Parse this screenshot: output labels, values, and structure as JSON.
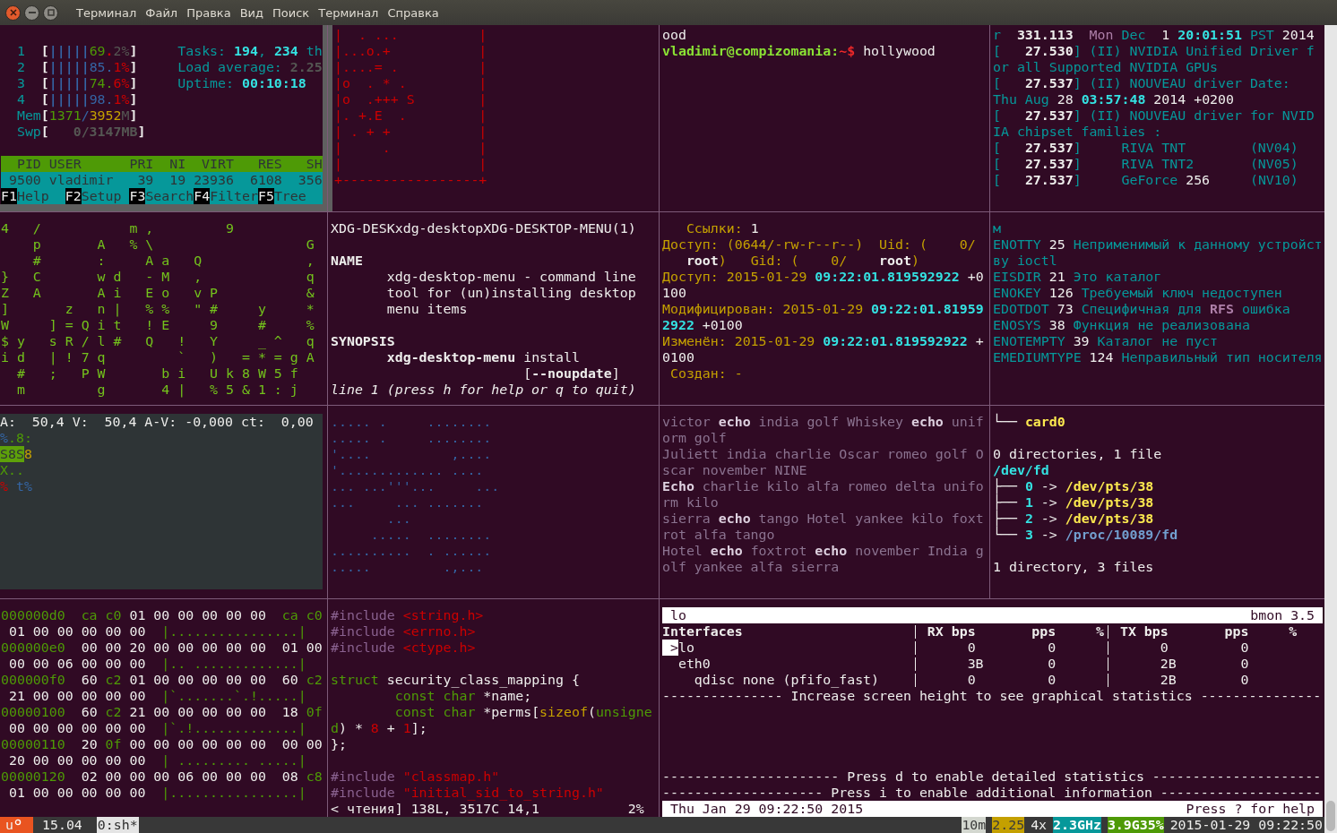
{
  "window": {
    "menu": [
      "Терминал",
      "Файл",
      "Правка",
      "Вид",
      "Поиск",
      "Терминал",
      "Справка"
    ]
  },
  "panes": [
    {
      "kind": "htop",
      "color": "#eeeeec",
      "lines": [
        {
          "kind": "blank"
        },
        {
          "kind": "text",
          "spans": [
            {
              "text": "  1  ",
              "color": "#06989a"
            },
            {
              "text": "[",
              "bold": true
            },
            {
              "text": "|||||",
              "color": "#3465a4",
              "bold": true
            },
            {
              "text": "69",
              "color": "#4e9a06"
            },
            {
              "text": ".",
              "color": "#cc0000",
              "bold": true
            },
            {
              "text": "2%",
              "color": "#555753"
            },
            {
              "text": "]",
              "bold": true
            },
            {
              "text": "     Tasks: ",
              "color": "#06989a"
            },
            {
              "text": "194",
              "color": "#34e2e2",
              "bold": true
            },
            {
              "text": ", ",
              "color": "#06989a"
            },
            {
              "text": "234",
              "color": "#34e2e2",
              "bold": true
            },
            {
              "text": " th",
              "color": "#06989a"
            }
          ]
        },
        {
          "kind": "text",
          "spans": [
            {
              "text": "  2  ",
              "color": "#06989a"
            },
            {
              "text": "[",
              "bold": true
            },
            {
              "text": "|||||",
              "color": "#3465a4",
              "bold": true
            },
            {
              "text": "85.",
              "color": "#3465a4"
            },
            {
              "text": "1%",
              "color": "#cc0000"
            },
            {
              "text": "]",
              "bold": true
            },
            {
              "text": "     Load average: ",
              "color": "#06989a"
            },
            {
              "text": "2.25",
              "color": "#555753",
              "bold": true
            }
          ]
        },
        {
          "kind": "text",
          "spans": [
            {
              "text": "  3  ",
              "color": "#06989a"
            },
            {
              "text": "[",
              "bold": true
            },
            {
              "text": "|||||",
              "color": "#3465a4",
              "bold": true
            },
            {
              "text": "74.",
              "color": "#4e9a06"
            },
            {
              "text": "6%",
              "color": "#cc0000"
            },
            {
              "text": "]",
              "bold": true
            },
            {
              "text": "     Uptime: ",
              "color": "#06989a"
            },
            {
              "text": "00:10:18",
              "color": "#34e2e2",
              "bold": true
            }
          ]
        },
        {
          "kind": "text",
          "spans": [
            {
              "text": "  4  ",
              "color": "#06989a"
            },
            {
              "text": "[",
              "bold": true
            },
            {
              "text": "|||||",
              "color": "#3465a4",
              "bold": true
            },
            {
              "text": "98.",
              "color": "#3465a4"
            },
            {
              "text": "1%",
              "color": "#cc0000"
            },
            {
              "text": "]",
              "bold": true
            }
          ]
        },
        {
          "kind": "text",
          "spans": [
            {
              "text": "  Mem",
              "color": "#06989a"
            },
            {
              "text": "[",
              "bold": true
            },
            {
              "text": "1371",
              "color": "#4e9a06"
            },
            {
              "text": "/",
              "color": "#3465a4"
            },
            {
              "text": "3952",
              "color": "#c4a000"
            },
            {
              "text": "M",
              "color": "#555753"
            },
            {
              "text": "]",
              "bold": true
            }
          ]
        },
        {
          "kind": "text",
          "spans": [
            {
              "text": "  Swp",
              "color": "#06989a"
            },
            {
              "text": "[",
              "bold": true
            },
            {
              "text": "   0/3147MB",
              "color": "#555753",
              "bold": true
            },
            {
              "text": "]",
              "bold": true
            }
          ]
        },
        {
          "kind": "blank"
        },
        {
          "kind": "text",
          "spans": [
            {
              "text": "  PID USER      PRI  NI  VIRT   RES   SH",
              "color": "#4e9a06",
              "inverse": true
            }
          ]
        },
        {
          "kind": "text",
          "spans": [
            {
              "text": " 9500 vladimir   39  19 23936  6108  356",
              "color": "#06989a",
              "inverse": true
            }
          ]
        },
        {
          "kind": "text",
          "spans": [
            {
              "text": "F1",
              "color": "#000000",
              "inverse": true
            },
            {
              "text": "Help  ",
              "color": "#06989a",
              "inverse": true
            },
            {
              "text": "F2",
              "color": "#000000",
              "inverse": true
            },
            {
              "text": "Setup ",
              "color": "#06989a",
              "inverse": true
            },
            {
              "text": "F3",
              "color": "#000000",
              "inverse": true
            },
            {
              "text": "Search",
              "color": "#06989a",
              "inverse": true
            },
            {
              "text": "F4",
              "color": "#000000",
              "inverse": true
            },
            {
              "text": "Filter",
              "color": "#06989a",
              "inverse": true
            },
            {
              "text": "F5",
              "color": "#000000",
              "inverse": true
            },
            {
              "text": "Tree  ",
              "color": "#06989a",
              "inverse": true
            }
          ]
        }
      ]
    },
    {
      "kind": "randomart",
      "color": "#cc0000",
      "lines": [
        {
          "kind": "text",
          "spans": [
            {
              "text": "|  . ...          |"
            }
          ]
        },
        {
          "kind": "text",
          "spans": [
            {
              "text": "|...o.+           |"
            }
          ]
        },
        {
          "kind": "text",
          "spans": [
            {
              "text": "|....= .          |"
            }
          ]
        },
        {
          "kind": "text",
          "spans": [
            {
              "text": "|o  . * .         |"
            }
          ]
        },
        {
          "kind": "text",
          "spans": [
            {
              "text": "|o  .+++ S        |"
            }
          ]
        },
        {
          "kind": "text",
          "spans": [
            {
              "text": "|. +.E  .         |"
            }
          ]
        },
        {
          "kind": "text",
          "spans": [
            {
              "text": "| . + +           |"
            }
          ]
        },
        {
          "kind": "text",
          "spans": [
            {
              "text": "|     .           |"
            }
          ]
        },
        {
          "kind": "text",
          "spans": [
            {
              "text": "|                 |"
            }
          ]
        },
        {
          "kind": "text",
          "spans": [
            {
              "text": "+-----------------+"
            }
          ]
        }
      ]
    },
    {
      "kind": "shell",
      "color": "#eeeeec",
      "lines": [
        {
          "kind": "text",
          "spans": [
            {
              "text": "ood"
            }
          ]
        },
        {
          "kind": "text",
          "spans": [
            {
              "text": "vladimir@compizomania:",
              "color": "#8ae234",
              "bold": true
            },
            {
              "text": "~$",
              "color": "#ef2929",
              "bold": true
            },
            {
              "text": " hollywood"
            }
          ]
        }
      ]
    },
    {
      "kind": "log",
      "color": "#06989a",
      "lines": [
        {
          "kind": "text",
          "spans": [
            {
              "text": "r  "
            },
            {
              "text": "331.113  ",
              "color": "#eeeeec",
              "bold": true
            },
            {
              "text": "Mon",
              "color": "#ad7fa8"
            },
            {
              "text": " Dec  "
            },
            {
              "text": "1 ",
              "color": "#eeeeec"
            },
            {
              "text": "20:01:51",
              "color": "#34e2e2",
              "bold": true
            },
            {
              "text": " PST "
            },
            {
              "text": "2014",
              "color": "#eeeeec"
            }
          ]
        },
        {
          "kind": "text",
          "spans": [
            {
              "text": "[   "
            },
            {
              "text": "27.530",
              "color": "#eeeeec",
              "bold": true
            },
            {
              "text": "] (II) NVIDIA Unified Driver f"
            }
          ]
        },
        {
          "kind": "text",
          "spans": [
            {
              "text": "or all Supported NVIDIA GPUs"
            }
          ]
        },
        {
          "kind": "text",
          "spans": [
            {
              "text": "[   "
            },
            {
              "text": "27.537",
              "color": "#eeeeec",
              "bold": true
            },
            {
              "text": "] (II) NOUVEAU driver Date:"
            }
          ]
        },
        {
          "kind": "text",
          "spans": [
            {
              "text": "Thu Aug "
            },
            {
              "text": "28 ",
              "color": "#eeeeec"
            },
            {
              "text": "03:57:48",
              "color": "#34e2e2",
              "bold": true
            },
            {
              "text": " 2014 +0200",
              "color": "#eeeeec"
            }
          ]
        },
        {
          "kind": "text",
          "spans": [
            {
              "text": "[   "
            },
            {
              "text": "27.537",
              "color": "#eeeeec",
              "bold": true
            },
            {
              "text": "] (II) NOUVEAU driver for NVID"
            }
          ]
        },
        {
          "kind": "text",
          "spans": [
            {
              "text": "IA chipset families :"
            }
          ]
        },
        {
          "kind": "text",
          "spans": [
            {
              "text": "[   "
            },
            {
              "text": "27.537",
              "color": "#eeeeec",
              "bold": true
            },
            {
              "text": "]     RIVA TNT        (NV04)"
            }
          ]
        },
        {
          "kind": "text",
          "spans": [
            {
              "text": "[   "
            },
            {
              "text": "27.537",
              "color": "#eeeeec",
              "bold": true
            },
            {
              "text": "]     RIVA TNT2       (NV05)"
            }
          ]
        },
        {
          "kind": "text",
          "spans": [
            {
              "text": "[   "
            },
            {
              "text": "27.537",
              "color": "#eeeeec",
              "bold": true
            },
            {
              "text": "]     GeForce "
            },
            {
              "text": "256",
              "color": "#eeeeec"
            },
            {
              "text": "     (NV10)"
            }
          ]
        }
      ]
    },
    {
      "kind": "matrix",
      "color": "#73c21c",
      "lines": [
        {
          "kind": "text",
          "spans": [
            {
              "text": "4   /           m ,         9"
            }
          ]
        },
        {
          "kind": "text",
          "spans": [
            {
              "text": "    p       A   % \\                   G"
            }
          ]
        },
        {
          "kind": "text",
          "spans": [
            {
              "text": "    #       :     A a   Q             ,"
            }
          ]
        },
        {
          "kind": "text",
          "spans": [
            {
              "text": "}   C       w d   - M   ,             q"
            }
          ]
        },
        {
          "kind": "text",
          "spans": [
            {
              "text": "Z   A       A i   E o   v P           &"
            }
          ]
        },
        {
          "kind": "text",
          "spans": [
            {
              "text": "]       z   n |   % %   \" #     y     *"
            }
          ]
        },
        {
          "kind": "text",
          "spans": [
            {
              "text": "W     ] = Q i t   ! E     9     #     %"
            }
          ]
        },
        {
          "kind": "text",
          "spans": [
            {
              "text": "$ y   s R / l #   Q   !   Y     _ ^   q"
            }
          ]
        },
        {
          "kind": "text",
          "spans": [
            {
              "text": "i d   | ! 7 q         `   )   = * = g A"
            }
          ]
        },
        {
          "kind": "text",
          "spans": [
            {
              "text": "  #   ;   P W       b i   U k 8 W 5 f"
            }
          ]
        },
        {
          "kind": "text",
          "spans": [
            {
              "text": "  m         g       4 |   % 5 & 1 : j"
            }
          ]
        }
      ]
    },
    {
      "kind": "manpage",
      "color": "#eeeeec",
      "lines": [
        {
          "kind": "text",
          "spans": [
            {
              "text": "XDG-DESKxdg-desktopXDG-DESKTOP-MENU(1)"
            }
          ]
        },
        {
          "kind": "blank"
        },
        {
          "kind": "text",
          "spans": [
            {
              "text": "NAME",
              "bold": true
            }
          ]
        },
        {
          "kind": "text",
          "spans": [
            {
              "text": "       xdg-desktop-menu - command line"
            }
          ]
        },
        {
          "kind": "text",
          "spans": [
            {
              "text": "       tool for (un)installing desktop"
            }
          ]
        },
        {
          "kind": "text",
          "spans": [
            {
              "text": "       menu items"
            }
          ]
        },
        {
          "kind": "blank"
        },
        {
          "kind": "text",
          "spans": [
            {
              "text": "SYNOPSIS",
              "bold": true
            }
          ]
        },
        {
          "kind": "text",
          "spans": [
            {
              "text": "       xdg-desktop-menu",
              "bold": true
            },
            {
              "text": " install"
            }
          ]
        },
        {
          "kind": "text",
          "spans": [
            {
              "text": "                        ["
            },
            {
              "text": "--noupdate",
              "bold": true
            },
            {
              "text": "]"
            }
          ]
        },
        {
          "kind": "text",
          "spans": [
            {
              "text": "line 1 (press h for help or q to quit)",
              "italic": true
            }
          ]
        }
      ]
    },
    {
      "kind": "stat",
      "color": "#c4a000",
      "lines": [
        {
          "kind": "text",
          "spans": [
            {
              "text": "   Ссылки: "
            },
            {
              "text": "1",
              "color": "#eeeeec"
            }
          ]
        },
        {
          "kind": "text",
          "spans": [
            {
              "text": "Доступ: (0644/-rw-r--r--)  Uid: (    0/"
            }
          ]
        },
        {
          "kind": "text",
          "spans": [
            {
              "text": "   root",
              "color": "#eeeeec",
              "bold": true
            },
            {
              "text": ")   Gid: (    0/    "
            },
            {
              "text": "root",
              "color": "#eeeeec",
              "bold": true
            },
            {
              "text": ")"
            }
          ]
        },
        {
          "kind": "text",
          "spans": [
            {
              "text": "Доступ: 2015-01-29 "
            },
            {
              "text": "09:22:01.819592922",
              "color": "#34e2e2",
              "bold": true
            },
            {
              "text": " +0",
              "color": "#eeeeec"
            }
          ]
        },
        {
          "kind": "text",
          "spans": [
            {
              "text": "100",
              "color": "#eeeeec"
            }
          ]
        },
        {
          "kind": "text",
          "spans": [
            {
              "text": "Модифицирован: 2015-01-29 "
            },
            {
              "text": "09:22:01.81959",
              "color": "#34e2e2",
              "bold": true
            }
          ]
        },
        {
          "kind": "text",
          "spans": [
            {
              "text": "2922",
              "color": "#34e2e2",
              "bold": true
            },
            {
              "text": " +0100",
              "color": "#eeeeec"
            }
          ]
        },
        {
          "kind": "text",
          "spans": [
            {
              "text": "Изменён: 2015-01-29 "
            },
            {
              "text": "09:22:01.819592922",
              "color": "#34e2e2",
              "bold": true
            },
            {
              "text": " +",
              "color": "#eeeeec"
            }
          ]
        },
        {
          "kind": "text",
          "spans": [
            {
              "text": "0100",
              "color": "#eeeeec"
            }
          ]
        },
        {
          "kind": "text",
          "spans": [
            {
              "text": " Создан: -"
            }
          ]
        }
      ]
    },
    {
      "kind": "errno",
      "color": "#06989a",
      "lines": [
        {
          "kind": "text",
          "spans": [
            {
              "text": "м"
            }
          ]
        },
        {
          "kind": "text",
          "spans": [
            {
              "text": "ENOTTY "
            },
            {
              "text": "25",
              "color": "#eeeeec"
            },
            {
              "text": " Неприменимый к данному устройст"
            }
          ]
        },
        {
          "kind": "text",
          "spans": [
            {
              "text": "ву ioctl"
            }
          ]
        },
        {
          "kind": "text",
          "spans": [
            {
              "text": "EISDIR "
            },
            {
              "text": "21",
              "color": "#eeeeec"
            },
            {
              "text": " Это каталог"
            }
          ]
        },
        {
          "kind": "text",
          "spans": [
            {
              "text": "ENOKEY "
            },
            {
              "text": "126",
              "color": "#eeeeec"
            },
            {
              "text": " Требуемый ключ недоступен"
            }
          ]
        },
        {
          "kind": "text",
          "spans": [
            {
              "text": "EDOTDOT "
            },
            {
              "text": "73",
              "color": "#eeeeec"
            },
            {
              "text": " Специфичная для "
            },
            {
              "text": "RFS",
              "color": "#ad7fa8",
              "bold": true
            },
            {
              "text": " ошибка"
            }
          ]
        },
        {
          "kind": "text",
          "spans": [
            {
              "text": "ENOSYS "
            },
            {
              "text": "38",
              "color": "#eeeeec"
            },
            {
              "text": " Функция не реализована"
            }
          ]
        },
        {
          "kind": "text",
          "spans": [
            {
              "text": "ENOTEMPTY "
            },
            {
              "text": "39",
              "color": "#eeeeec"
            },
            {
              "text": " Каталог не пуст"
            }
          ]
        },
        {
          "kind": "text",
          "spans": [
            {
              "text": "EMEDIUMTYPE "
            },
            {
              "text": "124",
              "color": "#eeeeec"
            },
            {
              "text": " Неправильный тип носителя"
            }
          ]
        }
      ]
    },
    {
      "kind": "video",
      "color": "#eeeeec",
      "lines": [
        {
          "kind": "text",
          "spans": [
            {
              "text": "A:  50,4 V:  50,4 A-V: -0,000 ct:  0,00"
            }
          ]
        },
        {
          "kind": "text",
          "spans": [
            {
              "text": "%",
              "color": "#3465a4"
            },
            {
              "text": ".8:",
              "color": "#4e9a06"
            }
          ]
        },
        {
          "kind": "text",
          "spans": [
            {
              "text": "S8S",
              "color": "#5ea10a",
              "inverse": true
            },
            {
              "text": "8",
              "color": "#c4a000"
            }
          ]
        },
        {
          "kind": "text",
          "spans": [
            {
              "text": "X..",
              "color": "#4e9a06"
            }
          ]
        },
        {
          "kind": "text",
          "spans": [
            {
              "text": "%",
              "color": "#cc0000"
            },
            {
              "text": " t%",
              "color": "#3465a4"
            }
          ]
        }
      ]
    },
    {
      "kind": "dots",
      "color": "#3465a4",
      "lines": [
        {
          "kind": "text",
          "spans": [
            {
              "text": "..... .     ........"
            }
          ]
        },
        {
          "kind": "text",
          "spans": [
            {
              "text": "..... .     ........"
            }
          ]
        },
        {
          "kind": "text",
          "spans": [
            {
              "text": "'....          ,...."
            }
          ]
        },
        {
          "kind": "text",
          "spans": [
            {
              "text": "'............. ...."
            }
          ]
        },
        {
          "kind": "text",
          "spans": [
            {
              "text": "... ...'''...     ..."
            }
          ]
        },
        {
          "kind": "text",
          "spans": [
            {
              "text": "...     ... ......."
            }
          ]
        },
        {
          "kind": "text",
          "spans": [
            {
              "text": "       ..."
            }
          ]
        },
        {
          "kind": "text",
          "spans": [
            {
              "text": "     .....  ........"
            }
          ]
        },
        {
          "kind": "text",
          "spans": [
            {
              "text": "..........  . ......"
            }
          ]
        },
        {
          "kind": "text",
          "spans": [
            {
              "text": ".....         .,..."
            }
          ]
        }
      ]
    },
    {
      "kind": "words",
      "color": "#8b7390",
      "lines": [
        {
          "kind": "text",
          "spans": [
            {
              "text": "victor "
            },
            {
              "text": "echo",
              "color": "#ddd0df",
              "bold": true
            },
            {
              "text": " india golf Whiskey "
            },
            {
              "text": "echo",
              "color": "#ddd0df",
              "bold": true
            },
            {
              "text": " unif"
            }
          ]
        },
        {
          "kind": "text",
          "spans": [
            {
              "text": "orm golf"
            }
          ]
        },
        {
          "kind": "text",
          "spans": [
            {
              "text": "Juliett india charlie Oscar romeo golf O"
            }
          ]
        },
        {
          "kind": "text",
          "spans": [
            {
              "text": "scar november NINE"
            }
          ]
        },
        {
          "kind": "text",
          "spans": [
            {
              "text": "Echo",
              "color": "#ddd0df",
              "bold": true
            },
            {
              "text": " charlie kilo alfa romeo delta unifo"
            }
          ]
        },
        {
          "kind": "text",
          "spans": [
            {
              "text": "rm kilo"
            }
          ]
        },
        {
          "kind": "text",
          "spans": [
            {
              "text": "sierra "
            },
            {
              "text": "echo",
              "color": "#ddd0df",
              "bold": true
            },
            {
              "text": " tango Hotel yankee kilo foxt"
            }
          ]
        },
        {
          "kind": "text",
          "spans": [
            {
              "text": "rot alfa tango"
            }
          ]
        },
        {
          "kind": "text",
          "spans": [
            {
              "text": "Hotel "
            },
            {
              "text": "echo",
              "color": "#ddd0df",
              "bold": true
            },
            {
              "text": " foxtrot "
            },
            {
              "text": "echo",
              "color": "#ddd0df",
              "bold": true
            },
            {
              "text": " november India g"
            }
          ]
        },
        {
          "kind": "text",
          "spans": [
            {
              "text": "olf yankee alfa sierra"
            }
          ]
        }
      ]
    },
    {
      "kind": "tree",
      "color": "#eeeeec",
      "lines": [
        {
          "kind": "text",
          "spans": [
            {
              "text": "└── "
            },
            {
              "text": "card0",
              "color": "#fce94f",
              "bold": true
            }
          ]
        },
        {
          "kind": "blank"
        },
        {
          "kind": "text",
          "spans": [
            {
              "text": "0 directories, 1 file"
            }
          ]
        },
        {
          "kind": "text",
          "spans": [
            {
              "text": "/dev/fd",
              "color": "#34e2e2",
              "bold": true
            }
          ]
        },
        {
          "kind": "text",
          "spans": [
            {
              "text": "├── "
            },
            {
              "text": "0",
              "color": "#34e2e2",
              "bold": true
            },
            {
              "text": " -> "
            },
            {
              "text": "/dev/pts/38",
              "color": "#fce94f",
              "bold": true
            }
          ]
        },
        {
          "kind": "text",
          "spans": [
            {
              "text": "├── "
            },
            {
              "text": "1",
              "color": "#34e2e2",
              "bold": true
            },
            {
              "text": " -> "
            },
            {
              "text": "/dev/pts/38",
              "color": "#fce94f",
              "bold": true
            }
          ]
        },
        {
          "kind": "text",
          "spans": [
            {
              "text": "├── "
            },
            {
              "text": "2",
              "color": "#34e2e2",
              "bold": true
            },
            {
              "text": " -> "
            },
            {
              "text": "/dev/pts/38",
              "color": "#fce94f",
              "bold": true
            }
          ]
        },
        {
          "kind": "text",
          "spans": [
            {
              "text": "└── "
            },
            {
              "text": "3",
              "color": "#34e2e2",
              "bold": true
            },
            {
              "text": " -> "
            },
            {
              "text": "/proc/10089/fd",
              "color": "#729fcf",
              "bold": true
            }
          ]
        },
        {
          "kind": "blank"
        },
        {
          "kind": "text",
          "spans": [
            {
              "text": "1 directory, 3 files"
            }
          ]
        }
      ]
    },
    {
      "kind": "hexdump",
      "color": "#eeeeec",
      "lines": [
        {
          "kind": "text",
          "spans": [
            {
              "text": "000000d0  ca c0",
              "color": "#4e9a06"
            },
            {
              "text": " 01 00 00 00 00 00  "
            },
            {
              "text": "ca c0",
              "color": "#4e9a06"
            }
          ]
        },
        {
          "kind": "text",
          "spans": [
            {
              "text": " 01 00 00 00 00 00  "
            },
            {
              "text": "|................|",
              "color": "#4e9a06"
            }
          ]
        },
        {
          "kind": "text",
          "spans": [
            {
              "text": "000000e0",
              "color": "#4e9a06"
            },
            {
              "text": "  00 00 20 00 00 00 00 00  01 00"
            }
          ]
        },
        {
          "kind": "text",
          "spans": [
            {
              "text": " 00 00 06 00 00 00  "
            },
            {
              "text": "|.. .............|",
              "color": "#4e9a06"
            }
          ]
        },
        {
          "kind": "text",
          "spans": [
            {
              "text": "000000f0",
              "color": "#4e9a06"
            },
            {
              "text": "  60 "
            },
            {
              "text": "c2",
              "color": "#4e9a06"
            },
            {
              "text": " 01 00 00 00 00 00  60 "
            },
            {
              "text": "c2",
              "color": "#4e9a06"
            }
          ]
        },
        {
          "kind": "text",
          "spans": [
            {
              "text": " 21 00 00 00 00 00  "
            },
            {
              "text": "|`.......`.!.....|",
              "color": "#4e9a06"
            }
          ]
        },
        {
          "kind": "text",
          "spans": [
            {
              "text": "00000100",
              "color": "#4e9a06"
            },
            {
              "text": "  60 "
            },
            {
              "text": "c2",
              "color": "#4e9a06"
            },
            {
              "text": " 21 00 00 00 00 00  18 "
            },
            {
              "text": "0f",
              "color": "#4e9a06"
            }
          ]
        },
        {
          "kind": "text",
          "spans": [
            {
              "text": " 00 00 00 00 00 00  "
            },
            {
              "text": "|`.!.............|",
              "color": "#4e9a06"
            }
          ]
        },
        {
          "kind": "text",
          "spans": [
            {
              "text": "00000110",
              "color": "#4e9a06"
            },
            {
              "text": "  20 "
            },
            {
              "text": "0f",
              "color": "#4e9a06"
            },
            {
              "text": " 00 00 00 00 00 00  00 00"
            }
          ]
        },
        {
          "kind": "text",
          "spans": [
            {
              "text": " 20 00 00 00 00 00  "
            },
            {
              "text": "| ......... .....|",
              "color": "#4e9a06"
            }
          ]
        },
        {
          "kind": "text",
          "spans": [
            {
              "text": "00000120",
              "color": "#4e9a06"
            },
            {
              "text": "  02 00 00 00 06 00 00 00  08 "
            },
            {
              "text": "c8",
              "color": "#4e9a06"
            }
          ]
        },
        {
          "kind": "text",
          "spans": [
            {
              "text": " 01 00 00 00 00 00  "
            },
            {
              "text": "|................|",
              "color": "#4e9a06"
            }
          ]
        }
      ]
    },
    {
      "kind": "editor",
      "color": "#eeeeec",
      "lines": [
        {
          "kind": "text",
          "spans": [
            {
              "text": "#include ",
              "color": "#8a6290"
            },
            {
              "text": "<string.h>",
              "color": "#cc0000"
            }
          ]
        },
        {
          "kind": "text",
          "spans": [
            {
              "text": "#include ",
              "color": "#8a6290"
            },
            {
              "text": "<errno.h>",
              "color": "#cc0000"
            }
          ]
        },
        {
          "kind": "text",
          "spans": [
            {
              "text": "#include ",
              "color": "#8a6290"
            },
            {
              "text": "<ctype.h>",
              "color": "#cc0000"
            }
          ]
        },
        {
          "kind": "blank"
        },
        {
          "kind": "text",
          "spans": [
            {
              "text": "struct",
              "color": "#4e9a06"
            },
            {
              "text": " security_class_mapping {"
            }
          ]
        },
        {
          "kind": "text",
          "spans": [
            {
              "text": "        const char",
              "color": "#4e9a06"
            },
            {
              "text": " *name;"
            }
          ]
        },
        {
          "kind": "text",
          "spans": [
            {
              "text": "        const char",
              "color": "#4e9a06"
            },
            {
              "text": " *perms["
            },
            {
              "text": "sizeof",
              "color": "#c4a000"
            },
            {
              "text": "("
            },
            {
              "text": "unsigne",
              "color": "#4e9a06"
            }
          ]
        },
        {
          "kind": "text",
          "spans": [
            {
              "text": "d",
              "color": "#4e9a06"
            },
            {
              "text": ") * "
            },
            {
              "text": "8",
              "color": "#cc0000"
            },
            {
              "text": " + "
            },
            {
              "text": "1",
              "color": "#cc0000"
            },
            {
              "text": "];"
            }
          ]
        },
        {
          "kind": "text",
          "spans": [
            {
              "text": "};"
            }
          ]
        },
        {
          "kind": "blank"
        },
        {
          "kind": "text",
          "spans": [
            {
              "text": "#include ",
              "color": "#8a6290"
            },
            {
              "text": "\"classmap.h\"",
              "color": "#cc0000"
            }
          ]
        },
        {
          "kind": "text",
          "spans": [
            {
              "text": "#include ",
              "color": "#8a6290"
            },
            {
              "text": "\"initial_sid_to_string.h\"",
              "color": "#cc0000"
            }
          ]
        },
        {
          "kind": "text",
          "spans": [
            {
              "text": "< чтения] 138L, 3517C 14,1           2%"
            }
          ]
        }
      ]
    }
  ],
  "bmon": {
    "title": "lo",
    "version": "bmon 3.5",
    "cursor": ">",
    "columns": [
      "Interfaces",
      "RX bps",
      "pps",
      "%",
      "TX bps",
      "pps",
      "%"
    ],
    "interfaces": [
      {
        "name": "lo",
        "rx_bps": "0",
        "rx_pps": "0",
        "tx_bps": "0",
        "tx_pps": "0",
        "selected": true
      },
      {
        "name": "eth0",
        "rx_bps": "3B",
        "rx_pps": "0",
        "tx_bps": "2B",
        "tx_pps": "0",
        "selected": false,
        "children": [
          {
            "name": "qdisc none (pfifo_fast)",
            "rx_bps": "0",
            "rx_pps": "0",
            "tx_bps": "2B",
            "tx_pps": "0",
            "selected": false
          }
        ]
      }
    ],
    "graph_notice": "--------------- Increase screen height to see graphical statistics ---------------",
    "notices": [
      "---------------------- Press d to enable detailed statistics ---------------------",
      "-------------------- Press i to enable additional information --------------------"
    ],
    "footer_left": "Thu Jan 29 09:22:50 2015",
    "footer_right": "Press ? for help"
  },
  "status_bar": {
    "session_label": "u",
    "version": "15.04",
    "windows": [
      {
        "label": "0:sh*",
        "selected": true
      }
    ],
    "indicators": [
      {
        "text": "10m",
        "color": "#d3d7cf",
        "inverse": true
      },
      {
        "text": "2.25",
        "color": "#c4a000",
        "inverse": true
      },
      {
        "text": "4x",
        "color": "#eeeeec"
      },
      {
        "text": "2.3GHz",
        "color": "#06989a",
        "inverse": true,
        "bold": true
      },
      {
        "text": "3.9G35%",
        "color": "#4e9a06",
        "inverse": true,
        "bold": true
      },
      {
        "text": "2015-01-29 09:22:50",
        "color": "#eeeeec"
      }
    ]
  }
}
